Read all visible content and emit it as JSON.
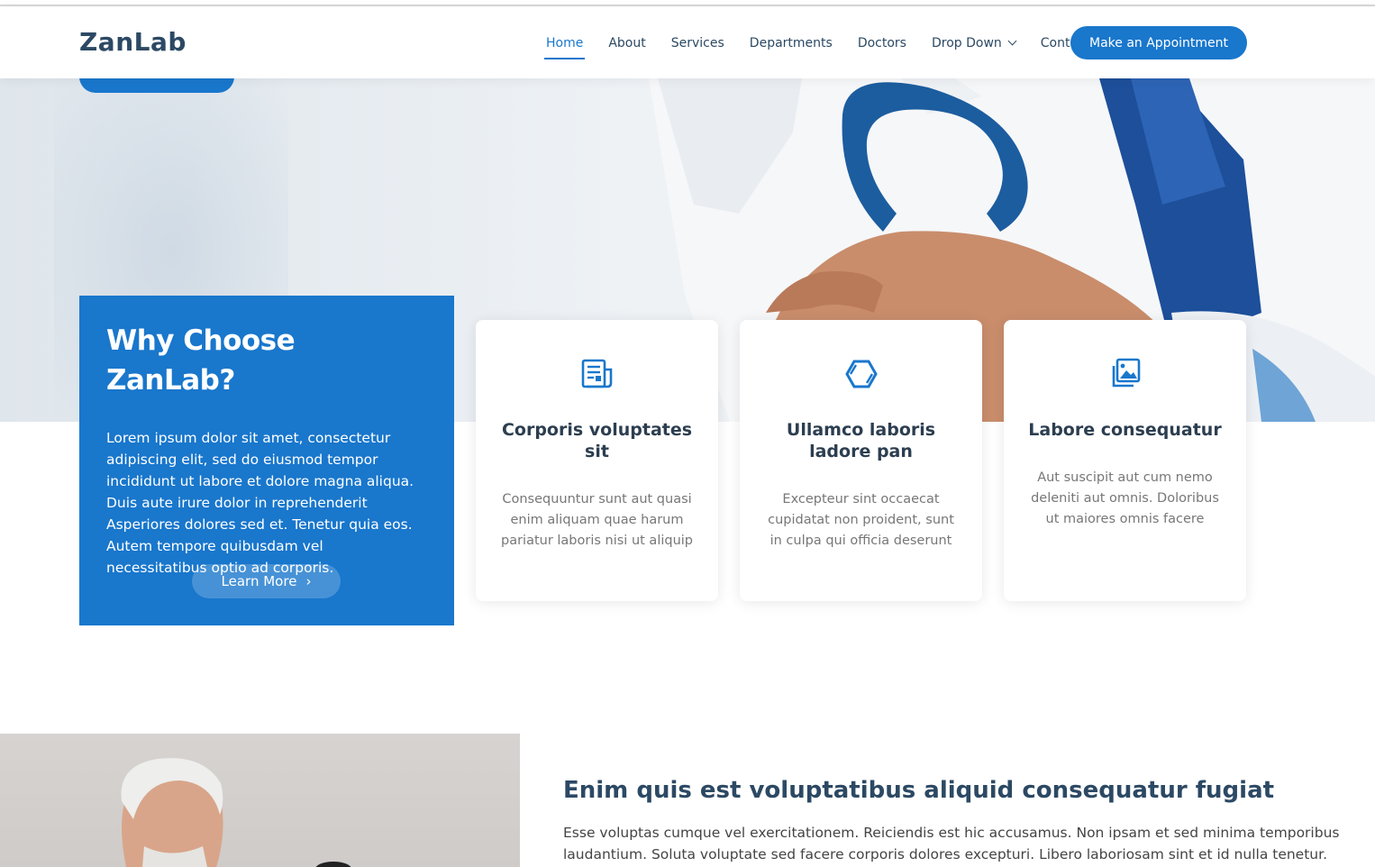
{
  "header": {
    "logo": "ZanLab",
    "nav": [
      "Home",
      "About",
      "Services",
      "Departments",
      "Doctors",
      "Drop Down",
      "Contact"
    ],
    "cta": "Make an Appointment"
  },
  "why": {
    "title": "Why Choose ZanLab?",
    "text": "Lorem ipsum dolor sit amet, consectetur adipiscing elit, sed do eiusmod tempor incididunt ut labore et dolore magna aliqua. Duis aute irure dolor in reprehenderit Asperiores dolores sed et. Tenetur quia eos. Autem tempore quibusdam vel necessitatibus optio ad corporis.",
    "button": "Learn More"
  },
  "cards": [
    {
      "icon": "newspaper-icon",
      "title": "Corporis voluptates sit",
      "text": "Consequuntur sunt aut quasi enim aliquam quae harum pariatur laboris nisi ut aliquip"
    },
    {
      "icon": "hexagon-icon",
      "title": "Ullamco laboris ladore pan",
      "text": "Excepteur sint occaecat cupidatat non proident, sunt in culpa qui officia deserunt"
    },
    {
      "icon": "images-icon",
      "title": "Labore consequatur",
      "text": "Aut suscipit aut cum nemo deleniti aut omnis. Doloribus ut maiores omnis facere"
    }
  ],
  "about": {
    "title": "Enim quis est voluptatibus aliquid consequatur fugiat",
    "text": "Esse voluptas cumque vel exercitationem. Reiciendis est hic accusamus. Non ipsam et sed minima temporibus laudantium. Soluta voluptate sed facere corporis dolores excepturi. Libero laboriosam sint et id nulla tenetur. Suscipit aut voluptate."
  },
  "colors": {
    "accent": "#1977cc",
    "heading": "#2c4964"
  }
}
